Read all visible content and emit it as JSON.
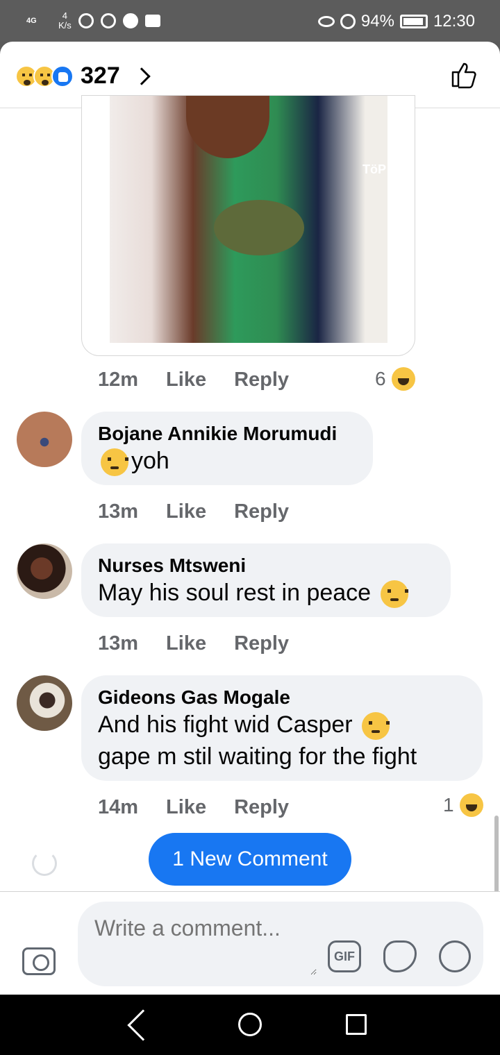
{
  "status_bar": {
    "network": "4G",
    "speed_value": "4",
    "speed_unit": "K/s",
    "battery": "94%",
    "time": "12:30"
  },
  "header": {
    "reaction_count": "327",
    "reactions": [
      "sad",
      "wow",
      "like"
    ]
  },
  "first_comment": {
    "time": "12m",
    "like_label": "Like",
    "reply_label": "Reply",
    "reaction_count": "6",
    "reaction": "haha"
  },
  "comments": [
    {
      "author": "Bojane Annikie Morumudi",
      "text": "yoh",
      "emoji": "crying",
      "time": "13m",
      "like_label": "Like",
      "reply_label": "Reply"
    },
    {
      "author": "Nurses Mtsweni",
      "text": "May his soul rest in peace",
      "emoji": "pensive",
      "time": "13m",
      "like_label": "Like",
      "reply_label": "Reply"
    },
    {
      "author": "Gideons Gas Mogale",
      "text_line1": "And his fight wid Casper",
      "text_line2": "gape m stil waiting for the fight",
      "emoji": "raised-eyebrow",
      "time": "14m",
      "like_label": "Like",
      "reply_label": "Reply",
      "reaction_count": "1",
      "reaction": "haha"
    }
  ],
  "new_comment_button": "1 New Comment",
  "composer": {
    "placeholder": "Write a comment...",
    "gif_label": "GIF"
  },
  "photo_tag": "TöP",
  "colors": {
    "accent": "#1877f2",
    "bubble": "#f0f2f5",
    "meta_text": "#65676b"
  }
}
